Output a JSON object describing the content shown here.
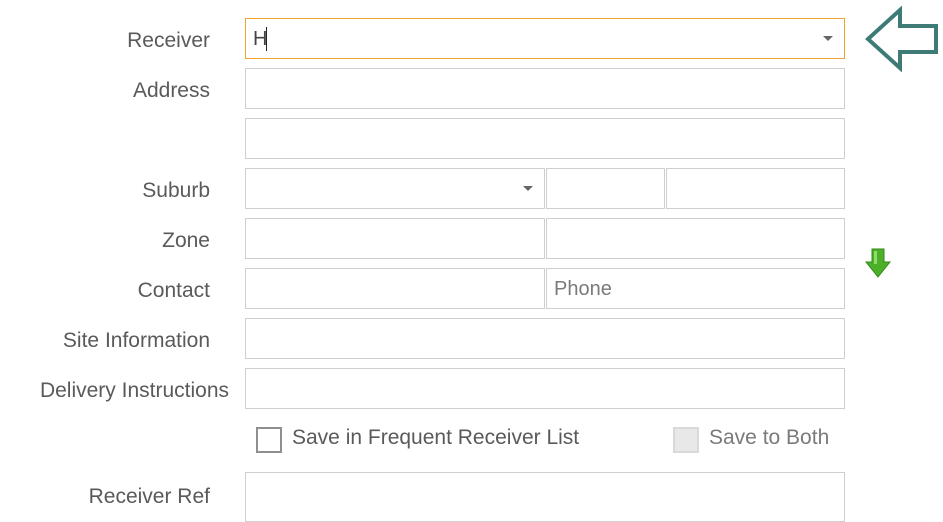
{
  "form": {
    "labels": {
      "receiver": "Receiver",
      "address": "Address",
      "suburb": "Suburb",
      "zone": "Zone",
      "contact": "Contact",
      "site_information": "Site Information",
      "delivery_instructions": "Delivery Instructions",
      "receiver_ref": "Receiver Ref"
    },
    "receiver_value": "H",
    "phone_placeholder": "Phone",
    "checkboxes": {
      "save_frequent": "Save in Frequent Receiver List",
      "save_both": "Save to Both"
    }
  },
  "icons": {
    "pointer_arrow": "left-arrow-outline-icon",
    "green_arrow": "green-down-arrow-icon"
  },
  "colors": {
    "focus_border": "#f0a12e",
    "pointer_arrow": "#3e7b77",
    "green_arrow": "#4caf2a"
  }
}
